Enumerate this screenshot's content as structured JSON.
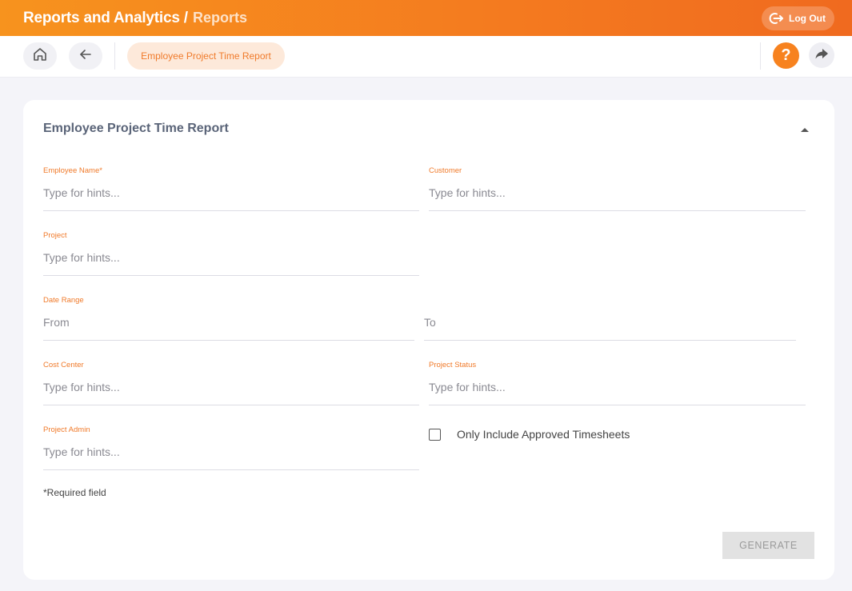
{
  "header": {
    "title": "Reports and Analytics",
    "separator": "/",
    "subtitle": "Reports",
    "logout_label": "Log Out"
  },
  "toolbar": {
    "active_tab": "Employee Project Time Report",
    "help_label": "?"
  },
  "card": {
    "title": "Employee Project Time Report",
    "fields": {
      "employee_name": {
        "label": "Employee Name",
        "required_mark": "*",
        "placeholder": "Type for hints..."
      },
      "customer": {
        "label": "Customer",
        "placeholder": "Type for hints..."
      },
      "project": {
        "label": "Project",
        "placeholder": "Type for hints..."
      },
      "date_range": {
        "label": "Date Range",
        "from_placeholder": "From",
        "to_placeholder": "To"
      },
      "cost_center": {
        "label": "Cost Center",
        "placeholder": "Type for hints..."
      },
      "project_status": {
        "label": "Project Status",
        "placeholder": "Type for hints..."
      },
      "project_admin": {
        "label": "Project Admin",
        "placeholder": "Type for hints..."
      }
    },
    "approved_checkbox_label": "Only Include Approved Timesheets",
    "approved_checked": false,
    "required_note": "*Required field",
    "generate_label": "GENERATE"
  },
  "colors": {
    "accent": "#f7821f",
    "label": "#f07a2a",
    "title": "#5a6478",
    "disabled_button": "#e2e2e2"
  },
  "icons": [
    "logout-icon",
    "home-icon",
    "arrow-left-icon",
    "help-icon",
    "share-icon",
    "chevron-up-icon"
  ]
}
